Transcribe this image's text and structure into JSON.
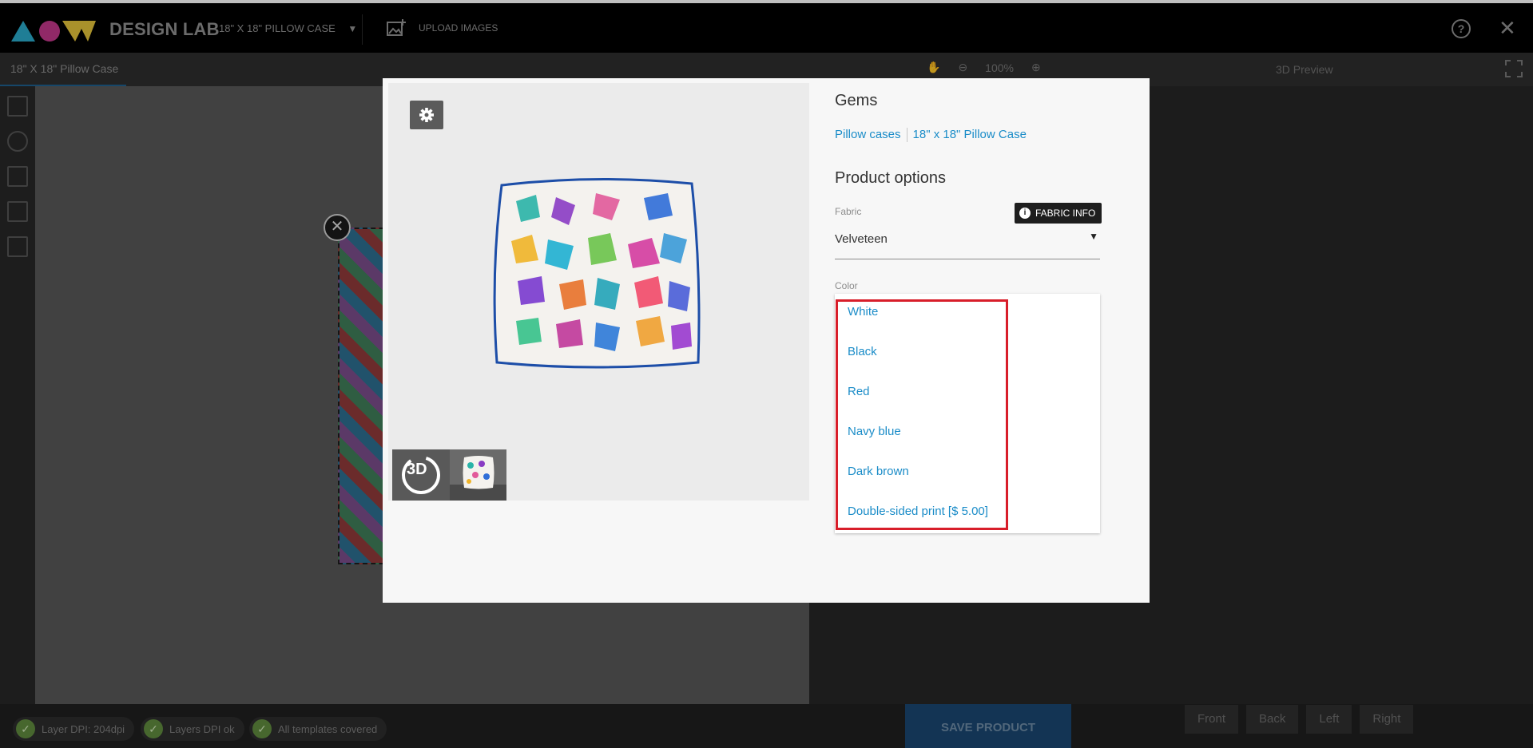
{
  "app": {
    "brand": "DESIGN LAB",
    "product_selector": "18\" X 18\" PILLOW CASE",
    "upload_label": "UPLOAD IMAGES"
  },
  "subbar": {
    "tab_label": "18\" X 18\" Pillow Case",
    "zoom_level": "100%",
    "preview_label": "3D Preview"
  },
  "status": {
    "layer_dpi": "Layer DPI: 204dpi",
    "layers_dpi_ok": "Layers DPI ok",
    "templates_covered": "All templates covered"
  },
  "actions": {
    "save_label": "SAVE PRODUCT"
  },
  "views": [
    "Front",
    "Back",
    "Left",
    "Right"
  ],
  "modal": {
    "title": "Gems",
    "breadcrumbs": [
      "Pillow cases",
      "18\" x 18\" Pillow Case"
    ],
    "gallery_3d_label": "3D",
    "options_title": "Product options",
    "fabric": {
      "label": "Fabric",
      "value": "Velveteen",
      "info_label": "FABRIC INFO"
    },
    "color": {
      "label": "Color",
      "options": [
        "White",
        "Black",
        "Red",
        "Navy blue",
        "Dark brown",
        "Double-sided print [$ 5.00]"
      ]
    }
  },
  "colors": {
    "accent_link": "#1a8cc8",
    "highlight": "#d81e2a",
    "save_button": "#1a4670",
    "status_ok": "#5f8a3e"
  }
}
